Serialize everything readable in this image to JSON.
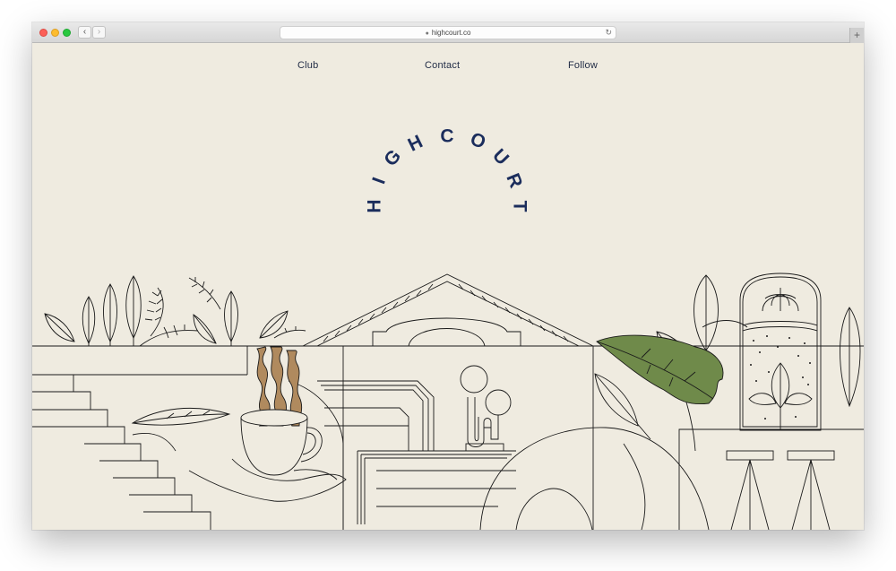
{
  "browser": {
    "url": "highcourt.co",
    "icons": [
      "lock-icon",
      "reload-icon",
      "back-arrow-icon",
      "forward-arrow-icon",
      "new-tab-icon"
    ],
    "back_glyph": "‹",
    "forward_glyph": "›",
    "new_tab_glyph": "+",
    "reload_glyph": "↻",
    "lock_glyph": "🔒"
  },
  "nav": {
    "items": [
      "Club",
      "Contact",
      "Follow"
    ]
  },
  "brand": {
    "name": "HIGHCOURT",
    "letters": [
      "H",
      "I",
      "G",
      "H",
      "C",
      "O",
      "U",
      "R",
      "T"
    ],
    "color": "#1b2d5c"
  },
  "colors": {
    "page_background": "#efebe0",
    "line": "#1a1a1a",
    "leaf_green": "#6f8a4a",
    "coffee_steam": "#b08a5e"
  }
}
